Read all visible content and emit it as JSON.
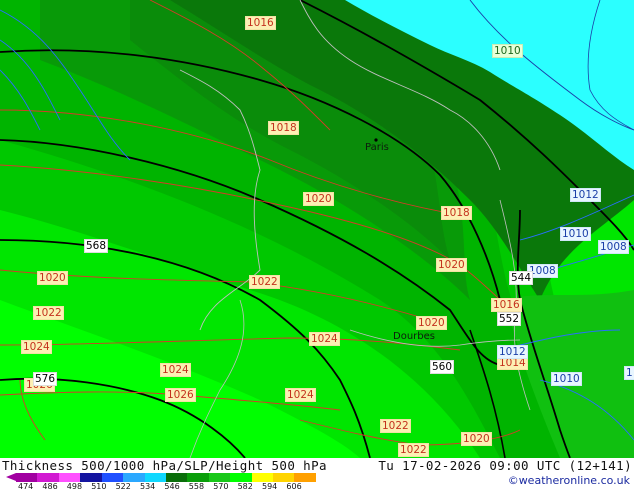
{
  "title": "Thickness 500/1000 hPa/SLP/Height 500 hPa",
  "datetime": "Tu 17-02-2026 09:00 UTC (12+141)",
  "credit": "©weatheronline.co.uk",
  "colorbar": {
    "ticks": [
      "474",
      "486",
      "498",
      "510",
      "522",
      "534",
      "546",
      "558",
      "570",
      "582",
      "594",
      "606"
    ],
    "colors": [
      "#a100a1",
      "#d21ad2",
      "#ff50ff",
      "#1414a0",
      "#2050ff",
      "#2ba8ff",
      "#10d8ff",
      "#0a6e0a",
      "#0a9e0a",
      "#19c819",
      "#00ff00",
      "#ffff00",
      "#ffd400",
      "#ffa000"
    ]
  },
  "map": {
    "city_labels": [
      "Paris",
      "Dourbes"
    ],
    "slp_labels": [
      "1016",
      "1018",
      "1020",
      "1018",
      "1020",
      "1020",
      "1022",
      "1020",
      "1022",
      "1024",
      "1024",
      "1026",
      "1024",
      "1026",
      "1024",
      "1020",
      "1016",
      "1014",
      "1022",
      "1022",
      "1020"
    ],
    "slp_blue_labels": [
      "1012",
      "1010",
      "1008",
      "1008",
      "1012",
      "1010",
      "1"
    ],
    "slp_green_labels": [
      "1010"
    ],
    "height_labels": [
      "568",
      "544",
      "552",
      "560",
      "576"
    ]
  }
}
